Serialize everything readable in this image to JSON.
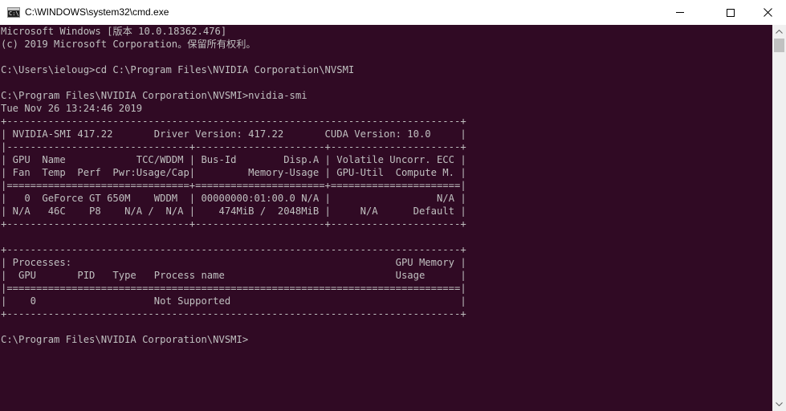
{
  "window": {
    "title": "C:\\WINDOWS\\system32\\cmd.exe",
    "icon_label": "C:\\"
  },
  "console": {
    "lines": [
      "Microsoft Windows [版本 10.0.18362.476]",
      "(c) 2019 Microsoft Corporation。保留所有权利。",
      "",
      "C:\\Users\\ieloug>cd C:\\Program Files\\NVIDIA Corporation\\NVSMI",
      "",
      "C:\\Program Files\\NVIDIA Corporation\\NVSMI>nvidia-smi",
      "Tue Nov 26 13:24:46 2019",
      "+-----------------------------------------------------------------------------+",
      "| NVIDIA-SMI 417.22       Driver Version: 417.22       CUDA Version: 10.0     |",
      "|-------------------------------+----------------------+----------------------+",
      "| GPU  Name            TCC/WDDM | Bus-Id        Disp.A | Volatile Uncorr. ECC |",
      "| Fan  Temp  Perf  Pwr:Usage/Cap|         Memory-Usage | GPU-Util  Compute M. |",
      "|===============================+======================+======================|",
      "|   0  GeForce GT 650M    WDDM  | 00000000:01:00.0 N/A |                  N/A |",
      "| N/A   46C    P8    N/A /  N/A |    474MiB /  2048MiB |     N/A      Default |",
      "+-------------------------------+----------------------+----------------------+",
      "",
      "+-----------------------------------------------------------------------------+",
      "| Processes:                                                       GPU Memory |",
      "|  GPU       PID   Type   Process name                             Usage      |",
      "|=============================================================================|",
      "|    0                    Not Supported                                       |",
      "+-----------------------------------------------------------------------------+",
      "",
      "C:\\Program Files\\NVIDIA Corporation\\NVSMI>"
    ]
  },
  "colors": {
    "console_background": "#300a24",
    "console_text": "#c0c0c0",
    "titlebar_background": "#ffffff"
  },
  "icons": {
    "minimize": "minimize-icon",
    "maximize": "maximize-icon",
    "close": "close-icon",
    "scroll_up": "scroll-up-arrow-icon",
    "scroll_down": "scroll-down-arrow-icon"
  }
}
